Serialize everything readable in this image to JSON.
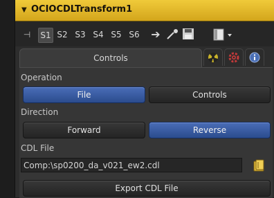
{
  "node": {
    "title": "OCIOCDLTransform1"
  },
  "toolbar": {
    "items": [
      "S1",
      "S2",
      "S3",
      "S4",
      "S5",
      "S6"
    ]
  },
  "tabs": {
    "controls": "Controls"
  },
  "colors": {
    "header": "#e3b82b",
    "selected": "#3a5fa8"
  },
  "operation": {
    "label": "Operation",
    "options": [
      "File",
      "Controls"
    ],
    "selected": "File"
  },
  "direction": {
    "label": "Direction",
    "options": [
      "Forward",
      "Reverse"
    ],
    "selected": "Reverse"
  },
  "cdl": {
    "label": "CDL File",
    "value": "Comp:\\sp0200_da_v021_ew2.cdl"
  },
  "export": {
    "label": "Export CDL File"
  }
}
